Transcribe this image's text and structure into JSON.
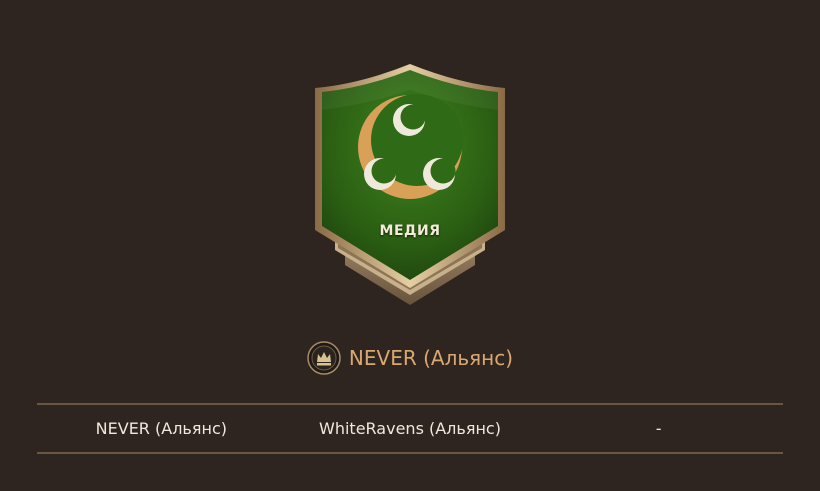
{
  "region": {
    "name": "МЕДИЯ",
    "banner_color": "#2f6a16",
    "crest_color": "#d9a058",
    "icon": "three-crescents-icon"
  },
  "owner": {
    "icon": "alliance-crown-icon",
    "name": "NEVER (Альянс)"
  },
  "table": {
    "row": [
      "NEVER (Альянс)",
      "WhiteRavens (Альянс)",
      "-"
    ]
  }
}
